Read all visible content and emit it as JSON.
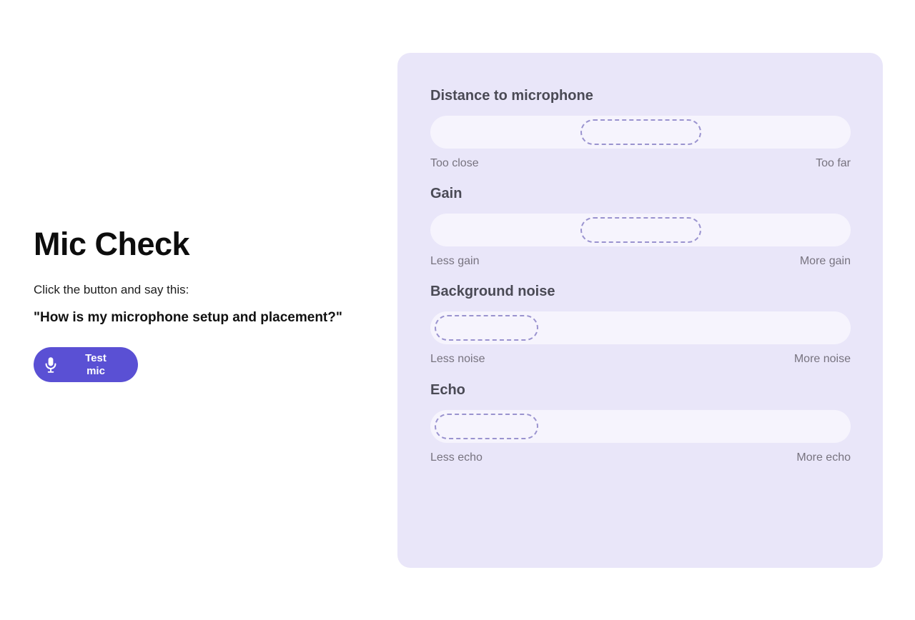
{
  "left": {
    "title": "Mic Check",
    "instruction": "Click the button and say this:",
    "phrase": "\"How is my microphone setup and placement?\"",
    "button_label": "Test mic",
    "button_icon": "microphone-icon",
    "button_color": "#5a50d4"
  },
  "panel": {
    "background_color": "#e9e6f9",
    "track_color": "#f6f4fd",
    "thumb_border_color": "#9a93cf",
    "sliders": [
      {
        "title": "Distance to microphone",
        "min_label": "Too close",
        "max_label": "Too far",
        "thumb_position": "center"
      },
      {
        "title": "Gain",
        "min_label": "Less gain",
        "max_label": "More gain",
        "thumb_position": "center"
      },
      {
        "title": "Background noise",
        "min_label": "Less noise",
        "max_label": "More noise",
        "thumb_position": "start"
      },
      {
        "title": "Echo",
        "min_label": "Less echo",
        "max_label": "More echo",
        "thumb_position": "start"
      }
    ]
  }
}
